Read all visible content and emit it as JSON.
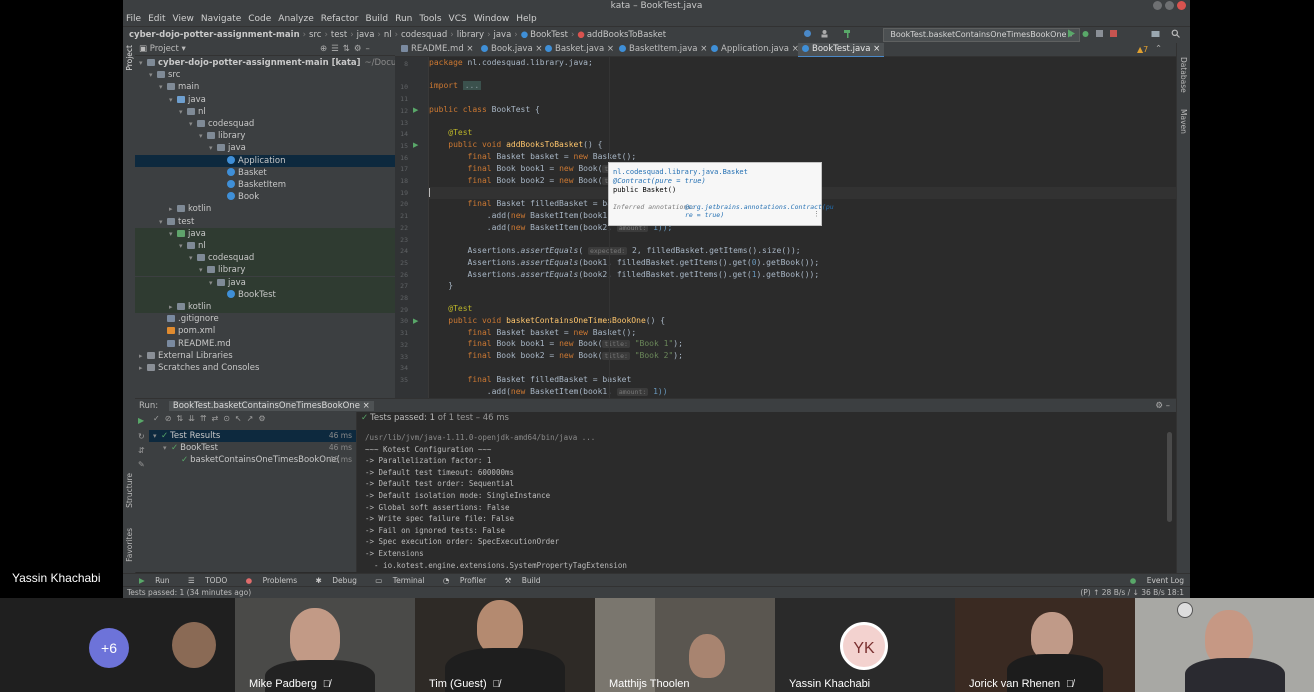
{
  "window": {
    "title": "kata – BookTest.java"
  },
  "menu": [
    "File",
    "Edit",
    "View",
    "Navigate",
    "Code",
    "Analyze",
    "Refactor",
    "Build",
    "Run",
    "Tools",
    "VCS",
    "Window",
    "Help"
  ],
  "breadcrumb": [
    "cyber-dojo-potter-assignment-main",
    "src",
    "test",
    "java",
    "nl",
    "codesquad",
    "library",
    "java",
    "BookTest",
    "addBooksToBasket"
  ],
  "run_config": "BookTest.basketContainsOneTimesBookOne",
  "project_panel": {
    "title": "Project",
    "tree": [
      {
        "label": "cyber-dojo-potter-assignment-main [kata]",
        "extra": "~/Documents/cybe",
        "indent": 0,
        "icon": "folder",
        "arrow": "▾"
      },
      {
        "label": "src",
        "indent": 1,
        "icon": "folder",
        "arrow": "▾"
      },
      {
        "label": "main",
        "indent": 2,
        "icon": "folder",
        "arrow": "▾"
      },
      {
        "label": "java",
        "indent": 3,
        "icon": "folder-src",
        "arrow": "▾"
      },
      {
        "label": "nl",
        "indent": 4,
        "icon": "folder",
        "arrow": "▾"
      },
      {
        "label": "codesquad",
        "indent": 5,
        "icon": "folder",
        "arrow": "▾"
      },
      {
        "label": "library",
        "indent": 6,
        "icon": "folder",
        "arrow": "▾"
      },
      {
        "label": "java",
        "indent": 7,
        "icon": "folder",
        "arrow": "▾"
      },
      {
        "label": "Application",
        "indent": 8,
        "icon": "class",
        "arrow": "",
        "selected": true
      },
      {
        "label": "Basket",
        "indent": 8,
        "icon": "class",
        "arrow": ""
      },
      {
        "label": "BasketItem",
        "indent": 8,
        "icon": "class",
        "arrow": ""
      },
      {
        "label": "Book",
        "indent": 8,
        "icon": "class",
        "arrow": ""
      },
      {
        "label": "kotlin",
        "indent": 3,
        "icon": "folder",
        "arrow": "▸"
      },
      {
        "label": "test",
        "indent": 2,
        "icon": "folder",
        "arrow": "▾"
      },
      {
        "label": "java",
        "indent": 3,
        "icon": "folder-test",
        "arrow": "▾",
        "green": true
      },
      {
        "label": "nl",
        "indent": 4,
        "icon": "folder",
        "arrow": "▾",
        "green": true
      },
      {
        "label": "codesquad",
        "indent": 5,
        "icon": "folder",
        "arrow": "▾",
        "green": true
      },
      {
        "label": "library",
        "indent": 6,
        "icon": "folder",
        "arrow": "▾",
        "green": true
      },
      {
        "label": "java",
        "indent": 7,
        "icon": "folder",
        "arrow": "▾",
        "green": true
      },
      {
        "label": "BookTest",
        "indent": 8,
        "icon": "class",
        "arrow": "",
        "green": true
      },
      {
        "label": "kotlin",
        "indent": 3,
        "icon": "folder",
        "arrow": "▸",
        "green": true
      },
      {
        "label": ".gitignore",
        "indent": 2,
        "icon": "file",
        "arrow": ""
      },
      {
        "label": "pom.xml",
        "indent": 2,
        "icon": "xml",
        "arrow": ""
      },
      {
        "label": "README.md",
        "indent": 2,
        "icon": "md",
        "arrow": ""
      },
      {
        "label": "External Libraries",
        "indent": 0,
        "icon": "lib",
        "arrow": "▸"
      },
      {
        "label": "Scratches and Consoles",
        "indent": 0,
        "icon": "lib",
        "arrow": "▸"
      }
    ]
  },
  "editor_tabs": [
    "README.md",
    "Book.java",
    "Basket.java",
    "BasketItem.java",
    "Application.java",
    "BookTest.java"
  ],
  "active_tab": "BookTest.java",
  "inspection": "▲7",
  "line_numbers": [
    "8",
    "",
    "10",
    "11",
    "12",
    "13",
    "14",
    "15",
    "16",
    "17",
    "18",
    "19",
    "20",
    "21",
    "22",
    "23",
    "24",
    "25",
    "26",
    "27",
    "28",
    "29",
    "30",
    "31",
    "32",
    "33",
    "34",
    "35"
  ],
  "code": {
    "l1": "package nl.codesquad.library.java;",
    "l2_kw": "import",
    "l2_chip": "...",
    "l3_kw": "public class",
    "l3_name": "BookTest",
    "l3_rest": " {",
    "ann": "@Test",
    "pv": "public void",
    "m1": "addBooksToBasket",
    "m1_rest": "() {",
    "final": "final",
    "basket_decl": " Basket basket = ",
    "new": "new",
    "basket_ctor": " Basket();",
    "book1_decl": " Book book1 = ",
    "book2_decl": " Book book2 = ",
    "book_ctor": " Book(",
    "title_hint": "title:",
    "filled_decl": " Basket filledBasket = basket",
    "add1": "            .add(",
    "bi1": " BasketItem(book1,",
    "bi2": " BasketItem(book2,",
    "amount_hint": "amount:",
    "one_close": " 1));",
    "assert_pre": "        Assertions.",
    "assert_fn": "assertEquals",
    "expected_hint": "expected:",
    "a1_rest": " 2, filledBasket.getItems().size());",
    "a2_rest": "(book1, filledBasket.getItems().get(",
    "a3_rest": "(book2, filledBasket.getItems().get(",
    "zero": "0",
    "one": "1",
    "get_book": ").getBook());",
    "close": "    }",
    "m2": "basketContainsOneTimesBookOne",
    "book1_str": "\"Book 1\"",
    "book2_str": "\"Book 2\"",
    "paren_semi": ");",
    "filled2_decl": " Basket filledBasket = basket",
    "bi1b": " BasketItem(book1,",
    "one_paren": " 1))"
  },
  "popup": {
    "line1": "nl.codesquad.library.java.Basket",
    "line2": "@Contract(pure = true)",
    "line3": "public Basket()",
    "inferred_label": "Inferred annotations:",
    "inferred_value": "@org.jetbrains.annotations.Contract(pu",
    "inferred_value2": "re = true)"
  },
  "right_tools": [
    "Database",
    "Maven"
  ],
  "left_tools": [
    "Project",
    "Structure",
    "Favorites"
  ],
  "run_panel": {
    "label": "Run:",
    "tab": "BookTest.basketContainsOneTimesBookOne",
    "tests_passed_text": "Tests passed:",
    "tests_passed_count": "1",
    "tests_passed_rest": "of 1 test – 46 ms",
    "tree": [
      {
        "label": "Test Results",
        "time": "46 ms",
        "indent": 0
      },
      {
        "label": "BookTest",
        "time": "46 ms",
        "indent": 1
      },
      {
        "label": "basketContainsOneTimesBookOne(",
        "time": "46 ms",
        "indent": 2
      }
    ],
    "console": [
      "/usr/lib/jvm/java-1.11.0-openjdk-amd64/bin/java ...",
      "~~~ Kotest Configuration ~~~",
      "-> Parallelization factor: 1",
      "-> Default test timeout: 600000ms",
      "-> Default test order: Sequential",
      "-> Default isolation mode: SingleInstance",
      "-> Global soft assertions: False",
      "-> Write spec failure file: False",
      "-> Fail on ignored tests: False",
      "-> Spec execution order: SpecExecutionOrder",
      "-> Extensions",
      "  - io.kotest.engine.extensions.SystemPropertyTagExtension"
    ]
  },
  "tool_windows": [
    "Run",
    "TODO",
    "Problems",
    "Debug",
    "Terminal",
    "Profiler",
    "Build"
  ],
  "event_log": "Event Log",
  "status": {
    "left": "Tests passed: 1 (34 minutes ago)",
    "right": "(P) ↑ 28 B/s / ↓ 36 B/s   18:1"
  },
  "video": {
    "presenter": "Yassin Khachabi",
    "more": "+6",
    "participants": [
      "Mike Padberg",
      "Tim (Guest)",
      "Matthijs Thoolen",
      "Yassin Khachabi",
      "Jorick van Rhenen"
    ],
    "initials": "YK",
    "mute_icon": "🎤̸"
  }
}
